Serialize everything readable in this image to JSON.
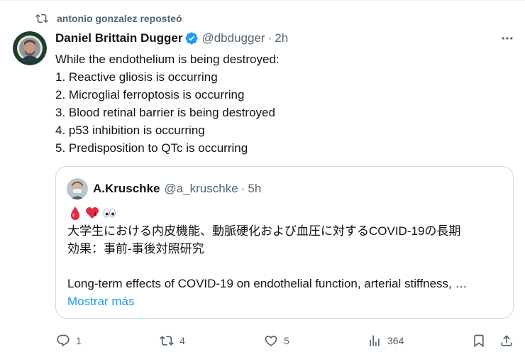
{
  "repost": {
    "text": "antonio gonzalez reposteó",
    "icon": "repost-icon"
  },
  "post": {
    "author_name": "Daniel Brittain Dugger",
    "handle": "@dbdugger",
    "separator": "·",
    "time": "2h",
    "verified_color": "#1d9bf0",
    "lines": [
      "While the endothelium is being destroyed:",
      "1. Reactive gliosis is occurring",
      "2. Microglial ferroptosis is occurring",
      "3. Blood retinal barrier is being destroyed",
      "4. p53 inhibition is occurring",
      "5. Predisposition to QTc is occurring"
    ]
  },
  "quote": {
    "author_name": "A.Kruschke",
    "handle": "@a_kruschke",
    "separator": "·",
    "time": "5h",
    "emojis": [
      "drop-of-blood",
      "red-heart-with-drop",
      "eyes"
    ],
    "jp_lines": [
      "大学生における内皮機能、動脈硬化および血圧に対するCOVID-19の長期",
      "効果：事前-事後対照研究"
    ],
    "en_line": "Long-term effects of COVID-19 on endothelial function, arterial stiffness, …",
    "show_more": "Mostrar más"
  },
  "actions": {
    "replies": "1",
    "reposts": "4",
    "likes": "5",
    "views": "364"
  },
  "colors": {
    "accent": "#1d9bf0",
    "muted": "#536471",
    "border": "#cfd9de",
    "text": "#0f1419"
  }
}
